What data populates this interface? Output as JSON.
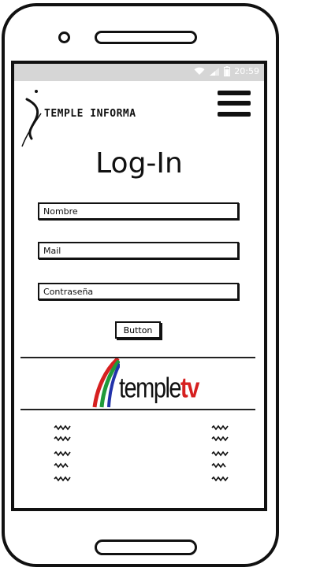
{
  "status": {
    "time": "20:59"
  },
  "header": {
    "brand": "TEMPLE INFORMA"
  },
  "login": {
    "title": "Log-In",
    "name_placeholder": "Nombre",
    "mail_placeholder": "Mail",
    "password_placeholder": "Contraseña",
    "button_label": "Button"
  },
  "partner": {
    "brand_prefix": "temple",
    "brand_suffix": "tv"
  },
  "footer": {
    "left_links": [
      "~~~",
      "~~~",
      "~~~",
      "~~",
      "~~~"
    ],
    "right_links": [
      "~~~",
      "~~~",
      "~~~",
      "~~",
      "~~~"
    ]
  },
  "colors": {
    "statusbar": "#d6d6d6",
    "tv_red": "#d62020",
    "tv_green": "#1f9a3a",
    "tv_blue": "#2233aa"
  }
}
